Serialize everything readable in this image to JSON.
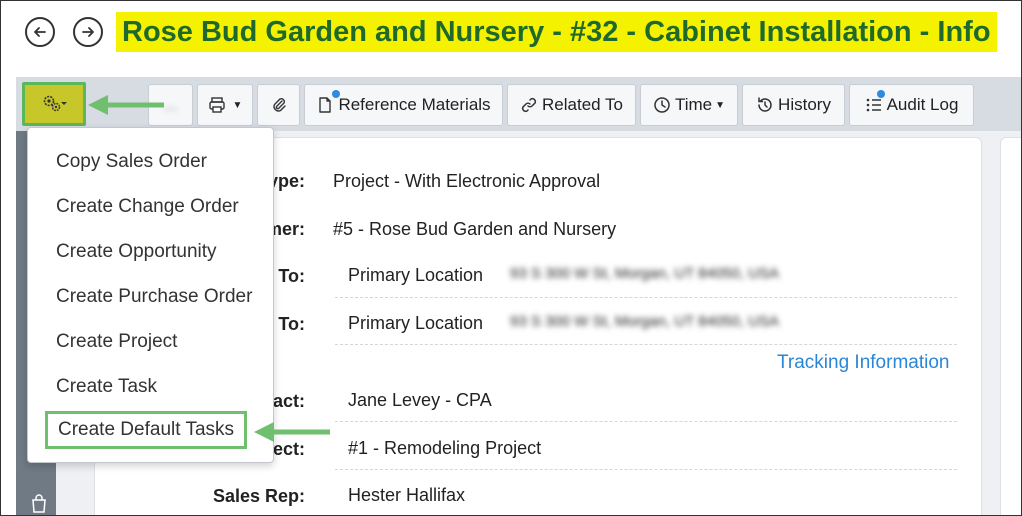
{
  "header": {
    "title": "Rose Bud Garden and Nursery - #32 - Cabinet Installation - Info"
  },
  "toolbar": {
    "hidden_label": "...",
    "reference_materials": "Reference Materials",
    "related_to": "Related To",
    "time": "Time",
    "history": "History",
    "audit_log": "Audit Log"
  },
  "menu": {
    "items": [
      "Copy Sales Order",
      "Create Change Order",
      "Create Opportunity",
      "Create Purchase Order",
      "Create Project",
      "Create Task",
      "Create Default Tasks"
    ]
  },
  "form": {
    "type_label": "ype:",
    "type_value": "Project - With Electronic Approval",
    "customer_label": "mer:",
    "customer_value": "#5 - Rose Bud Garden and Nursery",
    "bill_to_label": "To:",
    "bill_to_value": "Primary Location",
    "bill_to_address": "93 S 300 W St, Morgan, UT 84050, USA",
    "ship_to_label": "To:",
    "ship_to_value": "Primary Location",
    "ship_to_address": "93 S 300 W St, Morgan, UT 84050, USA",
    "tracking_link": "Tracking Information",
    "contact_label": "act:",
    "contact_value": "Jane Levey - CPA",
    "project_label": "ect:",
    "project_value": "#1 - Remodeling Project",
    "sales_rep_label": "Sales Rep:",
    "sales_rep_value": "Hester Hallifax"
  },
  "colors": {
    "title_highlight": "#f5f200",
    "title_text": "#1f6a2a",
    "annotation_green": "#5bb75b",
    "link_blue": "#2b86d6"
  }
}
